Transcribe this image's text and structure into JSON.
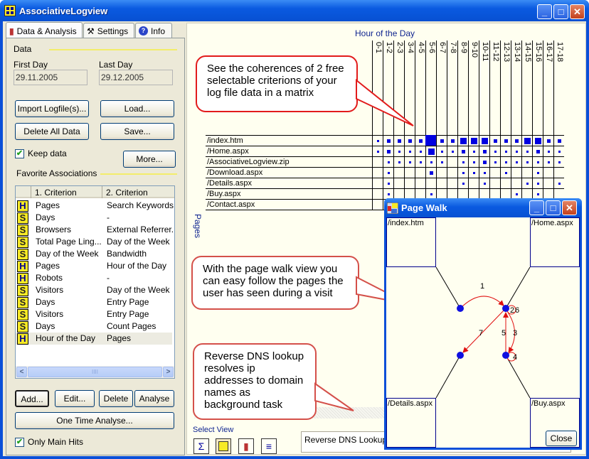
{
  "window": {
    "title": "AssociativeLogview",
    "controls": {
      "minimize": "_",
      "maximize": "□",
      "close": "✕"
    }
  },
  "tabs": [
    {
      "label": "Data & Analysis",
      "icon": "bar-chart-icon",
      "active": true
    },
    {
      "label": "Settings",
      "icon": "tools-icon",
      "active": false
    },
    {
      "label": "Info",
      "icon": "help-icon",
      "active": false
    }
  ],
  "data_section": {
    "heading": "Data",
    "first_day_label": "First Day",
    "first_day_value": "29.11.2005",
    "last_day_label": "Last Day",
    "last_day_value": "29.12.2005",
    "buttons": {
      "import": "Import Logfile(s)...",
      "load": "Load...",
      "delete_all": "Delete All Data",
      "save": "Save...",
      "more": "More..."
    },
    "keep_data_label": "Keep data",
    "keep_data_checked": true
  },
  "favorites": {
    "heading": "Favorite Associations",
    "columns": [
      "1. Criterion",
      "2. Criterion"
    ],
    "rows": [
      {
        "type": "H",
        "c1": "Pages",
        "c2": "Search Keywords"
      },
      {
        "type": "S",
        "c1": "Days",
        "c2": "-"
      },
      {
        "type": "S",
        "c1": "Browsers",
        "c2": "External Referrer..."
      },
      {
        "type": "S",
        "c1": "Total Page Ling...",
        "c2": "Day of the Week"
      },
      {
        "type": "S",
        "c1": "Day of the Week",
        "c2": "Bandwidth"
      },
      {
        "type": "H",
        "c1": "Pages",
        "c2": "Hour of the Day"
      },
      {
        "type": "H",
        "c1": "Robots",
        "c2": "-"
      },
      {
        "type": "S",
        "c1": "Visitors",
        "c2": "Day of the Week"
      },
      {
        "type": "S",
        "c1": "Days",
        "c2": "Entry Page"
      },
      {
        "type": "S",
        "c1": "Visitors",
        "c2": "Entry Page"
      },
      {
        "type": "S",
        "c1": "Days",
        "c2": "Count Pages"
      },
      {
        "type": "H",
        "c1": "Hour of the Day",
        "c2": "Pages",
        "selected": true
      }
    ],
    "scroll_thumb_grip": "IIII",
    "buttons": {
      "add": "Add...",
      "edit": "Edit...",
      "delete": "Delete",
      "analyse": "Analyse",
      "one_time": "One Time Analyse..."
    },
    "only_main_hits_label": "Only Main Hits",
    "only_main_hits_checked": true
  },
  "matrix": {
    "x_title": "Hour of the Day",
    "y_title": "Pages",
    "columns": [
      "0-1",
      "1-2",
      "2-3",
      "3-4",
      "4-5",
      "5-6",
      "6-7",
      "7-8",
      "8-9",
      "9-10",
      "10-11",
      "11-12",
      "12-13",
      "13-14",
      "14-15",
      "15-16",
      "16-17",
      "17-18"
    ],
    "rows": [
      "/index.htm",
      "/Home.aspx",
      "/AssociativeLogview.zip",
      "/Download.aspx",
      "/Details.aspx",
      "/Buy.aspx",
      "/Contact.aspx"
    ],
    "levels": [
      [
        1,
        2,
        2,
        2,
        2,
        4,
        2,
        2,
        3,
        3,
        3,
        2,
        2,
        2,
        3,
        3,
        2,
        2
      ],
      [
        1,
        2,
        1,
        1,
        1,
        3,
        1,
        1,
        2,
        1,
        2,
        1,
        1,
        1,
        1,
        2,
        1,
        1
      ],
      [
        0,
        1,
        1,
        1,
        1,
        1,
        1,
        0,
        1,
        1,
        2,
        1,
        1,
        1,
        1,
        1,
        1,
        1
      ],
      [
        0,
        1,
        0,
        0,
        0,
        2,
        0,
        0,
        1,
        1,
        1,
        0,
        1,
        0,
        0,
        1,
        0,
        0
      ],
      [
        0,
        1,
        0,
        0,
        0,
        0,
        0,
        0,
        1,
        0,
        1,
        0,
        0,
        0,
        1,
        1,
        0,
        1
      ],
      [
        0,
        1,
        0,
        0,
        0,
        1,
        0,
        0,
        0,
        0,
        0,
        0,
        0,
        1,
        0,
        1,
        0,
        0
      ],
      [
        0,
        0,
        0,
        0,
        0,
        0,
        0,
        0,
        0,
        0,
        0,
        0,
        0,
        0,
        0,
        0,
        0,
        0
      ]
    ]
  },
  "callouts": [
    {
      "text": "See the coherences of 2 free selectable criterions of your log file data in a matrix"
    },
    {
      "text": "With the page walk view you can easy follow the pages the user has seen during a visit"
    },
    {
      "text": "Reverse DNS lookup resolves ip addresses to domain names as background task"
    }
  ],
  "select_view": {
    "label": "Select View",
    "buttons": [
      {
        "name": "sum-view",
        "glyph": "Σ"
      },
      {
        "name": "matrix-view",
        "glyph": "▪"
      },
      {
        "name": "chart-view",
        "glyph": "▮"
      },
      {
        "name": "list-view",
        "glyph": "≡"
      }
    ]
  },
  "status_text": "Reverse DNS Lookup fir",
  "page_walk": {
    "title": "Page Walk",
    "boxes": [
      "/index.htm",
      "/Home.aspx",
      "/Details.aspx",
      "/Buy.aspx"
    ],
    "steps": [
      "1",
      "2",
      "3",
      "4",
      "5",
      "6",
      "7"
    ],
    "close_label": "Close"
  }
}
